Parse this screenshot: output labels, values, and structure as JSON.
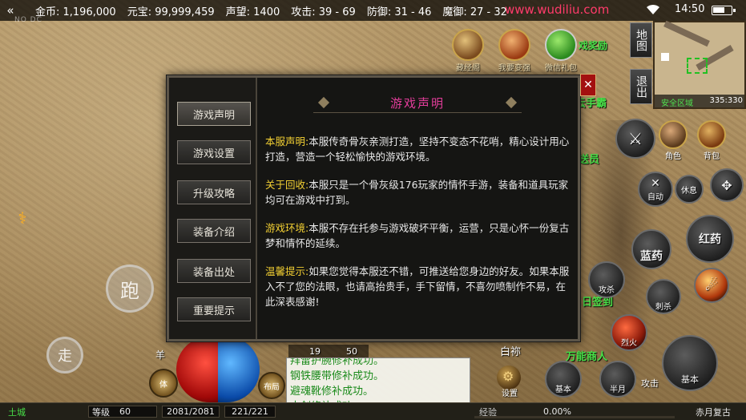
{
  "status_bar": {
    "back_glyph": "«",
    "gold": "金币: 1,196,000",
    "yuanbao": "元宝: 99,999,459",
    "prestige": "声望: 1400",
    "attack": "攻击: 39 - 69",
    "defense": "防御: 31 - 46",
    "magic_defense": "魔御: 27 - 32",
    "url": "www.wudiliu.com",
    "time": "14:50",
    "watermark": "NO DC"
  },
  "top_icons": [
    {
      "label": "藏经阁"
    },
    {
      "label": "我要变强"
    },
    {
      "label": "微信礼包"
    }
  ],
  "npc_tags": {
    "top": "戏奖励",
    "shou": "云手霸",
    "send": "送员",
    "sign": "日签到",
    "merchant": "万能商人",
    "north": "白祢"
  },
  "minimap": {
    "zone": "安全区域",
    "coords": "335:330",
    "map_button": "地图",
    "exit_button": "退出"
  },
  "dialog": {
    "title": "游戏声明",
    "close_glyph": "✕",
    "menu": [
      {
        "label": "游戏声明",
        "active": true
      },
      {
        "label": "游戏设置",
        "active": false
      },
      {
        "label": "升级攻略",
        "active": false
      },
      {
        "label": "装备介绍",
        "active": false
      },
      {
        "label": "装备出处",
        "active": false
      },
      {
        "label": "重要提示",
        "active": false
      }
    ],
    "sections": [
      {
        "keyword": "本服声明:",
        "text": "本服传奇骨灰亲测打造，坚持不变态不花哨，精心设计用心打造，营造一个轻松愉快的游戏环境。"
      },
      {
        "keyword": "关于回收:",
        "text": "本服只是一个骨灰级176玩家的情怀手游，装备和道具玩家均可在游戏中打到。"
      },
      {
        "keyword": "游戏环境:",
        "text": "本服不存在托参与游戏破坏平衡，运营，只是心怀一份复古梦和情怀的延续。"
      },
      {
        "keyword": "温馨提示:",
        "text": "如果您觉得本服还不错，可推送给您身边的好友。如果本服入不了您的法眼，也请高抬贵手，手下留情，不喜勿喷制作不易，在此深表感谢!"
      }
    ]
  },
  "right_panel": {
    "role": "角色",
    "bag": "背包",
    "auto": "自动",
    "rest": "休息",
    "blue_potion": "蓝药",
    "red_potion": "红药",
    "attack_mode": "攻击",
    "basic": "基本",
    "skill_a": "攻杀",
    "skill_b": "烈火",
    "skill_c": "刺杀",
    "skill_d": "半月"
  },
  "left_controls": {
    "run": "跑",
    "walk": "走"
  },
  "chat_log": [
    "拜雷护腕修补成功。",
    "钢铁腰带修补成功。",
    "避魂靴修补成功。",
    "木剑修补成功。"
  ],
  "hud": {
    "sheep": "羊",
    "num_a": "19",
    "num_b": "50",
    "body_btn": "体",
    "layout_btn": "布局",
    "set_btn": "设置"
  },
  "bottom_bar": {
    "map_name": "土城",
    "level_label": "等级",
    "level": "60",
    "hp": "2081/2081",
    "mp": "221/221",
    "exp_label": "经验",
    "exp": "0.00%",
    "revive": "赤月复古"
  }
}
